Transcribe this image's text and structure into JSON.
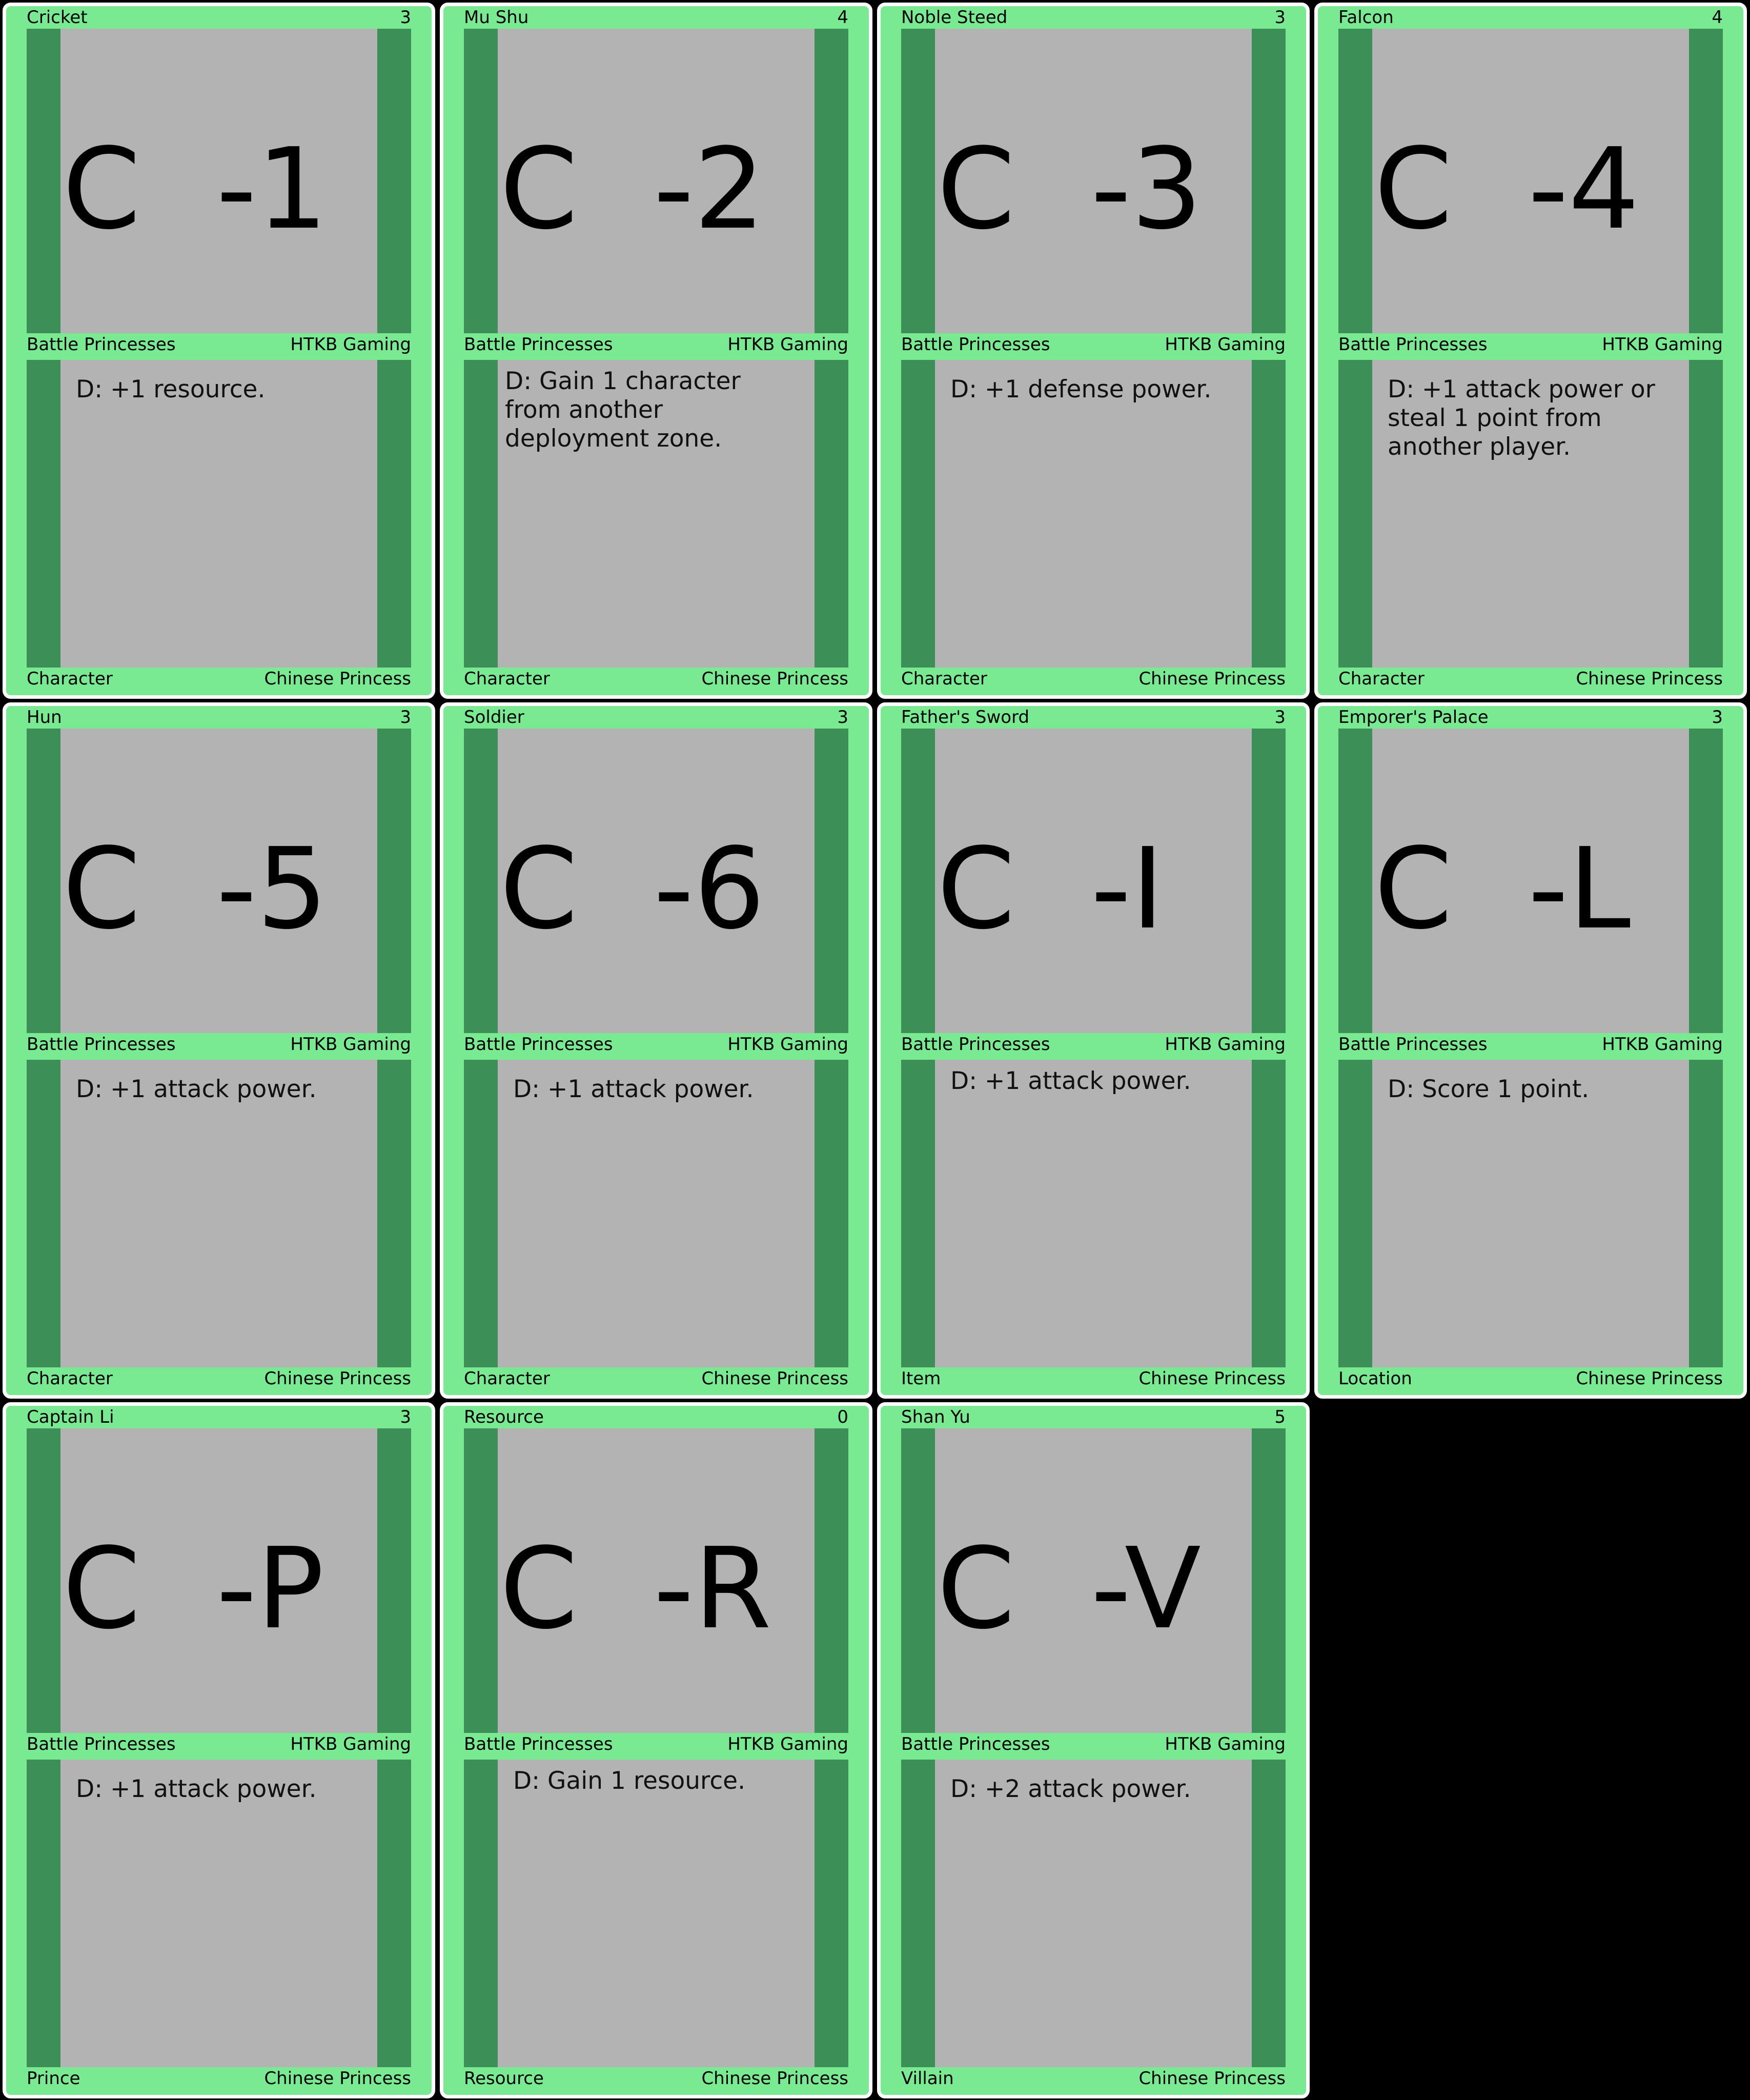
{
  "sheet": {
    "cards": [
      {
        "name": "Cricket",
        "cost": "3",
        "code_prefix": "C",
        "code_suffix": "-1",
        "set": "Battle Princesses",
        "publisher": "HTKB Gaming",
        "ability": "D: +1 resource.",
        "type": "Character",
        "subtype": "Chinese Princess"
      },
      {
        "name": "Mu Shu",
        "cost": "4",
        "code_prefix": "C",
        "code_suffix": "-2",
        "set": "Battle Princesses",
        "publisher": "HTKB Gaming",
        "ability": "D: Gain 1 character\nfrom another\ndeployment zone.",
        "type": "Character",
        "subtype": "Chinese Princess"
      },
      {
        "name": "Noble Steed",
        "cost": "3",
        "code_prefix": "C",
        "code_suffix": "-3",
        "set": "Battle Princesses",
        "publisher": "HTKB Gaming",
        "ability": "D: +1 defense power.",
        "type": "Character",
        "subtype": "Chinese Princess"
      },
      {
        "name": "Falcon",
        "cost": "4",
        "code_prefix": "C",
        "code_suffix": "-4",
        "set": "Battle Princesses",
        "publisher": "HTKB Gaming",
        "ability": "D: +1 attack power or\nsteal 1 point from\nanother player.",
        "type": "Character",
        "subtype": "Chinese Princess"
      },
      {
        "name": "Hun",
        "cost": "3",
        "code_prefix": "C",
        "code_suffix": "-5",
        "set": "Battle Princesses",
        "publisher": "HTKB Gaming",
        "ability": "D: +1 attack power.",
        "type": "Character",
        "subtype": "Chinese Princess"
      },
      {
        "name": "Soldier",
        "cost": "3",
        "code_prefix": "C",
        "code_suffix": "-6",
        "set": "Battle Princesses",
        "publisher": "HTKB Gaming",
        "ability": "D: +1 attack power.",
        "type": "Character",
        "subtype": "Chinese Princess"
      },
      {
        "name": "Father's Sword",
        "cost": "3",
        "code_prefix": "C",
        "code_suffix": "-I",
        "set": "Battle Princesses",
        "publisher": "HTKB Gaming",
        "ability": "D: +1 attack power.",
        "type": "Item",
        "subtype": "Chinese Princess"
      },
      {
        "name": "Emporer's Palace",
        "cost": "3",
        "code_prefix": "C",
        "code_suffix": "-L",
        "set": "Battle Princesses",
        "publisher": "HTKB Gaming",
        "ability": "D: Score 1 point.",
        "type": "Location",
        "subtype": "Chinese Princess"
      },
      {
        "name": "Captain Li",
        "cost": "3",
        "code_prefix": "C",
        "code_suffix": "-P",
        "set": "Battle Princesses",
        "publisher": "HTKB Gaming",
        "ability": "D: +1 attack power.",
        "type": "Prince",
        "subtype": "Chinese Princess"
      },
      {
        "name": "Resource",
        "cost": "0",
        "code_prefix": "C",
        "code_suffix": "-R",
        "set": "Battle Princesses",
        "publisher": "HTKB Gaming",
        "ability": "D: Gain 1 resource.",
        "type": "Resource",
        "subtype": "Chinese Princess"
      },
      {
        "name": "Shan Yu",
        "cost": "5",
        "code_prefix": "C",
        "code_suffix": "-V",
        "set": "Battle Princesses",
        "publisher": "HTKB Gaming",
        "ability": "D: +2 attack power.",
        "type": "Villain",
        "subtype": "Chinese Princess"
      }
    ]
  },
  "colors": {
    "background": "#000000",
    "card_frame": "#7aea92",
    "side_bar": "#3b8f57",
    "panel": "#b3b3b3",
    "border": "#ffffff"
  }
}
